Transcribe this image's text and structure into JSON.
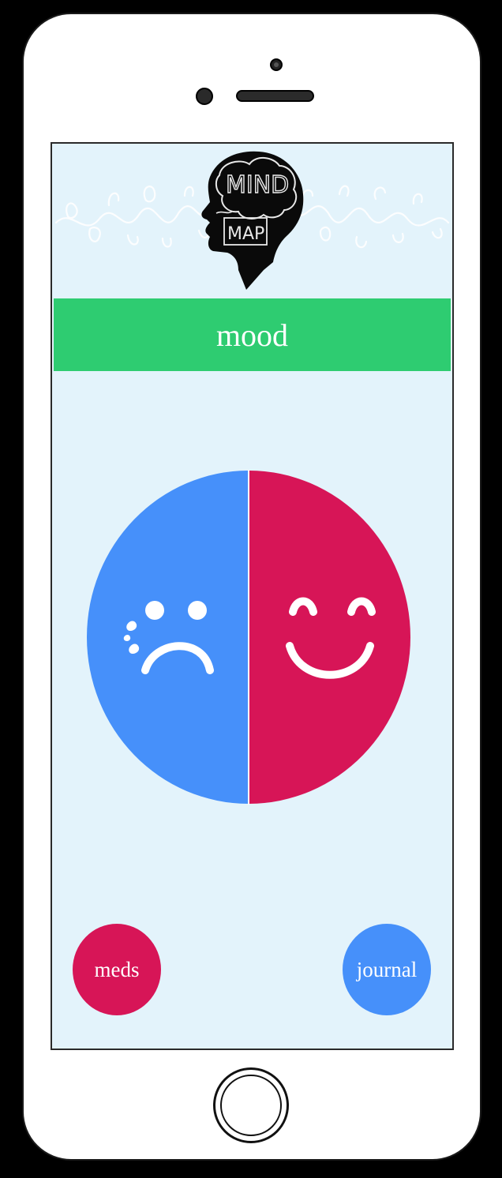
{
  "app": {
    "logo_text_top": "MIND",
    "logo_text_bottom": "MAP",
    "logo_icon": "head-brain-logo"
  },
  "header": {
    "title": "mood",
    "accent_color": "#2ecc71"
  },
  "mood_selector": {
    "sad_icon": "sad-face-icon",
    "happy_icon": "happy-face-icon",
    "sad_color": "#4690fa",
    "happy_color": "#d71557"
  },
  "nav": {
    "meds_label": "meds",
    "journal_label": "journal",
    "meds_color": "#d71557",
    "journal_color": "#4690fa"
  },
  "colors": {
    "screen_background": "#e3f3fb"
  }
}
